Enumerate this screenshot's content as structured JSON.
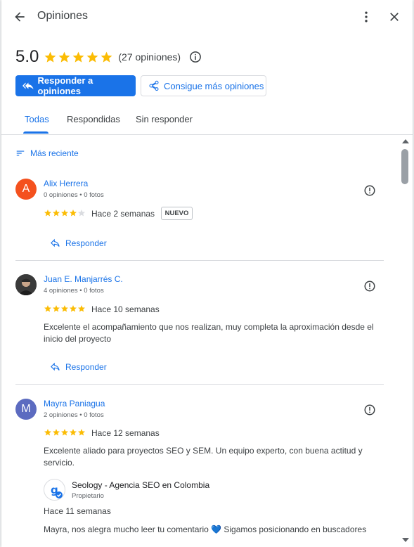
{
  "header": {
    "title": "Opiniones"
  },
  "summary": {
    "score": "5.0",
    "stars": 5,
    "count": "(27 opiniones)"
  },
  "actions": {
    "respond_label": "Responder a opiniones",
    "get_more_label": "Consigue más opiniones"
  },
  "tabs": [
    {
      "label": "Todas",
      "active": true
    },
    {
      "label": "Respondidas",
      "active": false
    },
    {
      "label": "Sin responder",
      "active": false
    }
  ],
  "sort": {
    "label": "Más reciente"
  },
  "reviews": [
    {
      "initial": "A",
      "avatar_color": "#f4511e",
      "name": "Alix Herrera",
      "meta": "0 opiniones • 0 fotos",
      "stars": 4,
      "when": "Hace 2 semanas",
      "badge": "NUEVO",
      "reply_label": "Responder"
    },
    {
      "initial": "",
      "avatar_color": "#4a4a4a",
      "name": "Juan E. Manjarrés C.",
      "meta": "4 opiniones • 0 fotos",
      "stars": 5,
      "when": "Hace 10 semanas",
      "text": "Excelente el acompañamiento que nos realizan, muy completa la aproximación desde el inicio del proyecto",
      "reply_label": "Responder"
    },
    {
      "initial": "M",
      "avatar_color": "#5c6bc0",
      "name": "Mayra Paniagua",
      "meta": "2 opiniones • 0 fotos",
      "stars": 5,
      "when": "Hace 12 semanas",
      "text": "Excelente aliado para proyectos SEO y SEM. Un equipo experto, con buena actitud y servicio.",
      "owner": {
        "name": "Seology - Agencia SEO en Colombia",
        "role": "Propietario",
        "when": "Hace 11 semanas",
        "text": "Mayra, nos alegra mucho leer tu comentario 💙 Sigamos posicionando en buscadores"
      }
    }
  ],
  "colors": {
    "accent": "#1a73e8",
    "star": "#fbbc04",
    "star_empty": "#dadce0"
  },
  "icons": [
    "arrow-back-icon",
    "more-vert-icon",
    "close-icon",
    "info-icon",
    "reply-all-icon",
    "share-icon",
    "sort-icon",
    "flag-icon",
    "reply-icon",
    "verified-icon"
  ]
}
